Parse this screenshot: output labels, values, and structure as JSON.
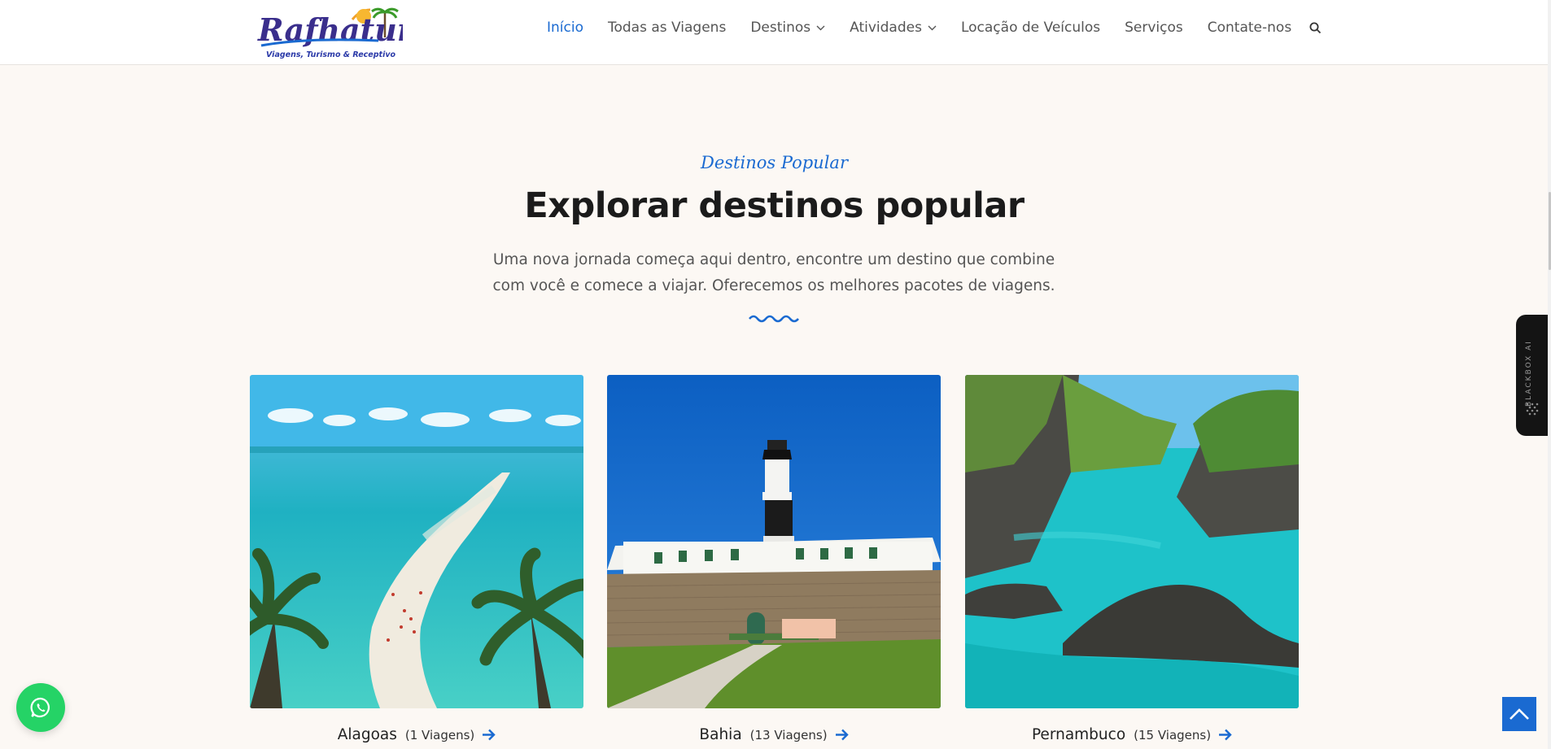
{
  "brand": {
    "logo_text": "Rafhatur",
    "logo_tagline": "Viagens, Turismo & Receptivo"
  },
  "nav": {
    "items": [
      {
        "label": "Início",
        "active": true
      },
      {
        "label": "Todas as Viagens"
      },
      {
        "label": "Destinos",
        "dropdown": true
      },
      {
        "label": "Atividades",
        "dropdown": true
      },
      {
        "label": "Locação de Veículos"
      },
      {
        "label": "Serviços"
      },
      {
        "label": "Contate-nos"
      }
    ],
    "search_icon": "search-icon"
  },
  "section": {
    "eyebrow": "Destinos Popular",
    "title": "Explorar destinos popular",
    "subtitle_line1": "Uma nova jornada começa aqui dentro, encontre um destino que combine",
    "subtitle_line2": "com você e comece a viajar. Oferecemos os melhores pacotes de viagens."
  },
  "destinations": [
    {
      "name": "Alagoas",
      "count": "(1 Viagens)"
    },
    {
      "name": "Bahia",
      "count": "(13 Viagens)"
    },
    {
      "name": "Pernambuco",
      "count": "(15 Viagens)"
    }
  ],
  "widgets": {
    "blackbox_label": "BLACKBOX AI",
    "whatsapp_icon": "whatsapp-icon",
    "back_to_top_icon": "chevron-up-icon"
  },
  "colors": {
    "accent": "#1a6ad1",
    "background": "#fcf8f4",
    "whatsapp": "#25d366"
  }
}
